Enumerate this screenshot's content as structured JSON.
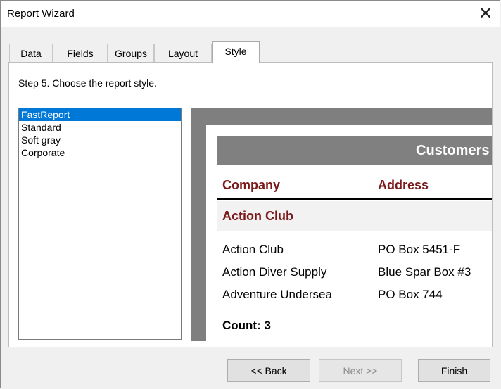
{
  "window": {
    "title": "Report Wizard",
    "close_glyph": "✕",
    "close_icon": "close-icon"
  },
  "tabs": [
    {
      "label": "Data"
    },
    {
      "label": "Fields"
    },
    {
      "label": "Groups"
    },
    {
      "label": "Layout"
    },
    {
      "label": "Style",
      "active": true
    }
  ],
  "step": "Step 5. Choose the report style.",
  "styles": {
    "items": [
      "FastReport",
      "Standard",
      "Soft gray",
      "Corporate"
    ],
    "selected": "FastReport"
  },
  "preview": {
    "title": "Customers",
    "columns": [
      "Company",
      "Address"
    ],
    "group_header": "Action Club",
    "rows": [
      {
        "company": "Action Club",
        "address": "PO Box 5451-F"
      },
      {
        "company": "Action Diver Supply",
        "address": "Blue Spar Box #3"
      },
      {
        "company": "Adventure Undersea",
        "address": "PO Box 744"
      }
    ],
    "count": "Count: 3"
  },
  "buttons": {
    "back": "<< Back",
    "next": "Next >>",
    "finish": "Finish"
  },
  "colors": {
    "accent": "#0078d7",
    "header_text": "#7b1a1a",
    "title_bar": "#808080"
  }
}
